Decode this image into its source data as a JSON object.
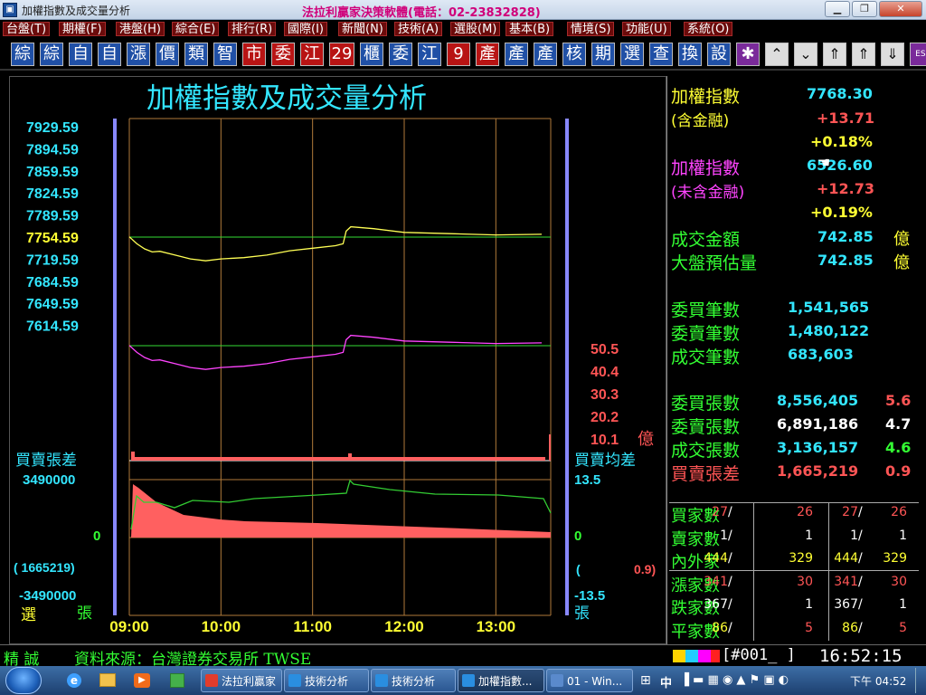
{
  "window": {
    "title": "加權指數及成交量分析",
    "banner": "法拉利贏家決策軟體(電話：02-23832828)"
  },
  "menu": [
    "台盤(T)",
    "期權(F)",
    "港盤(H)",
    "綜合(E)",
    "排行(R)",
    "國際(I)",
    "新聞(N)",
    "技術(A)",
    "選股(M)",
    "基本(B)",
    "情境(S)",
    "功能(U)",
    "系統(O)"
  ],
  "toolbar": [
    {
      "label": "綜",
      "color": "blue"
    },
    {
      "label": "綜",
      "color": "blue"
    },
    {
      "label": "自",
      "color": "blue"
    },
    {
      "label": "自",
      "color": "blue"
    },
    {
      "label": "漲",
      "color": "blue"
    },
    {
      "label": "價",
      "color": "blue"
    },
    {
      "label": "類",
      "color": "blue"
    },
    {
      "label": "智",
      "color": "blue"
    },
    {
      "label": "市",
      "color": "red"
    },
    {
      "label": "委",
      "color": "red"
    },
    {
      "label": "江",
      "color": "red"
    },
    {
      "label": "29",
      "color": "red"
    },
    {
      "label": "櫃",
      "color": "blue"
    },
    {
      "label": "委",
      "color": "blue"
    },
    {
      "label": "江",
      "color": "blue"
    },
    {
      "label": "9",
      "color": "red"
    },
    {
      "label": "產",
      "color": "red"
    },
    {
      "label": "產",
      "color": "blue"
    },
    {
      "label": "產",
      "color": "blue"
    },
    {
      "label": "核",
      "color": "blue"
    },
    {
      "label": "期",
      "color": "blue"
    },
    {
      "label": "選",
      "color": "blue"
    },
    {
      "label": "查",
      "color": "blue"
    },
    {
      "label": "換",
      "color": "blue"
    },
    {
      "label": "設",
      "color": "blue"
    },
    {
      "label": "✱",
      "color": "purple"
    },
    {
      "label": "⌃",
      "color": "gray"
    },
    {
      "label": "⌄",
      "color": "gray"
    },
    {
      "label": "⇑",
      "color": "gray"
    },
    {
      "label": "⇑",
      "color": "gray"
    },
    {
      "label": "⇓",
      "color": "gray"
    },
    {
      "label": "ESC",
      "color": "purple"
    }
  ],
  "chart_title": "加權指數及成交量分析",
  "chart_data": {
    "type": "line",
    "title": "加權指數及成交量分析",
    "x_ticks": [
      "09:00",
      "10:00",
      "11:00",
      "12:00",
      "13:00"
    ],
    "x_range": [
      "09:00",
      "13:30"
    ],
    "index_axis": {
      "ticks": [
        "7929.59",
        "7894.59",
        "7859.59",
        "7824.59",
        "7789.59",
        "7754.59",
        "7719.59",
        "7684.59",
        "7649.59",
        "7614.59"
      ],
      "reference": "7754.59"
    },
    "index_series": [
      {
        "t": "09:00",
        "v": 7755
      },
      {
        "t": "09:05",
        "v": 7744
      },
      {
        "t": "09:10",
        "v": 7736
      },
      {
        "t": "09:15",
        "v": 7731
      },
      {
        "t": "09:20",
        "v": 7732
      },
      {
        "t": "09:30",
        "v": 7726
      },
      {
        "t": "09:40",
        "v": 7720
      },
      {
        "t": "09:50",
        "v": 7717
      },
      {
        "t": "10:00",
        "v": 7720
      },
      {
        "t": "10:15",
        "v": 7722
      },
      {
        "t": "10:30",
        "v": 7726
      },
      {
        "t": "10:45",
        "v": 7733
      },
      {
        "t": "11:00",
        "v": 7737
      },
      {
        "t": "11:15",
        "v": 7741
      },
      {
        "t": "11:20",
        "v": 7744
      },
      {
        "t": "11:22",
        "v": 7764
      },
      {
        "t": "11:25",
        "v": 7771
      },
      {
        "t": "11:40",
        "v": 7768
      },
      {
        "t": "12:00",
        "v": 7762
      },
      {
        "t": "12:30",
        "v": 7760
      },
      {
        "t": "13:00",
        "v": 7758
      },
      {
        "t": "13:30",
        "v": 7759
      }
    ],
    "volume_axis": {
      "ticks": [
        "50.5",
        "40.4",
        "30.3",
        "20.2",
        "10.1"
      ],
      "unit": "億"
    },
    "balance_axis": {
      "left_label": "買賣張差",
      "left_ticks": [
        "3490000",
        "0",
        "-3490000"
      ],
      "right_label": "買賣均差",
      "right_ticks": [
        "13.5",
        "0",
        "-13.5"
      ]
    }
  },
  "left_labels": {
    "balance_value": "( 1665219)",
    "bottom_left": "選",
    "bottom_right": "張"
  },
  "right_labels": {
    "balance_value_open": "(",
    "balance_value": "0.9)",
    "bottom": "張"
  },
  "right_panel": {
    "index1": {
      "name": "加權指數",
      "sub": "(含金融)",
      "value": "7768.30",
      "change": "+13.71",
      "pct": "+0.18%"
    },
    "index2": {
      "name": "加權指數",
      "sub": "(未含金融)",
      "value": "6526.60",
      "change": "+12.73",
      "pct": "+0.19%"
    },
    "turnover": {
      "label": "成交金額",
      "value": "742.85",
      "unit": "億"
    },
    "estimate": {
      "label": "大盤預估量",
      "value": "742.85",
      "unit": "億"
    },
    "counts": [
      {
        "label": "委買筆數",
        "value": "1,541,565"
      },
      {
        "label": "委賣筆數",
        "value": "1,480,122"
      },
      {
        "label": "成交筆數",
        "value": "683,603"
      }
    ],
    "shares": [
      {
        "label": "委買張數",
        "value": "8,556,405",
        "ratio": "5.6"
      },
      {
        "label": "委賣張數",
        "value": "6,891,186",
        "ratio": "4.7"
      },
      {
        "label": "成交張數",
        "value": "3,136,157",
        "ratio": "4.6"
      },
      {
        "label": "買賣張差",
        "value": "1,665,219",
        "ratio": "0.9"
      }
    ],
    "breadth": [
      {
        "label": "買家數",
        "a": "27",
        "b": "26",
        "c": "27",
        "d": "26"
      },
      {
        "label": "賣家數",
        "a": "1",
        "b": "1",
        "c": "1",
        "d": "1"
      },
      {
        "label": "內外家",
        "a": "444",
        "b": "329",
        "c": "444",
        "d": "329"
      },
      {
        "label": "漲家數",
        "a": "341",
        "b": "30",
        "c": "341",
        "d": "30"
      },
      {
        "label": "跌家數",
        "a": "367",
        "b": "1",
        "c": "367",
        "d": "1"
      },
      {
        "label": "平家數",
        "a": "86",
        "b": "5",
        "c": "86",
        "d": "5"
      }
    ]
  },
  "status": {
    "user": "精 誠",
    "source": "資料來源：台灣證券交易所 TWSE",
    "page": "[#001_ ]",
    "time": "16:52:15"
  },
  "taskbar": {
    "items": [
      "法拉利贏家",
      "技術分析",
      "技術分析",
      "加權指數...",
      "01 - Win..."
    ],
    "tray": "中",
    "clock": "下午 04:52"
  }
}
